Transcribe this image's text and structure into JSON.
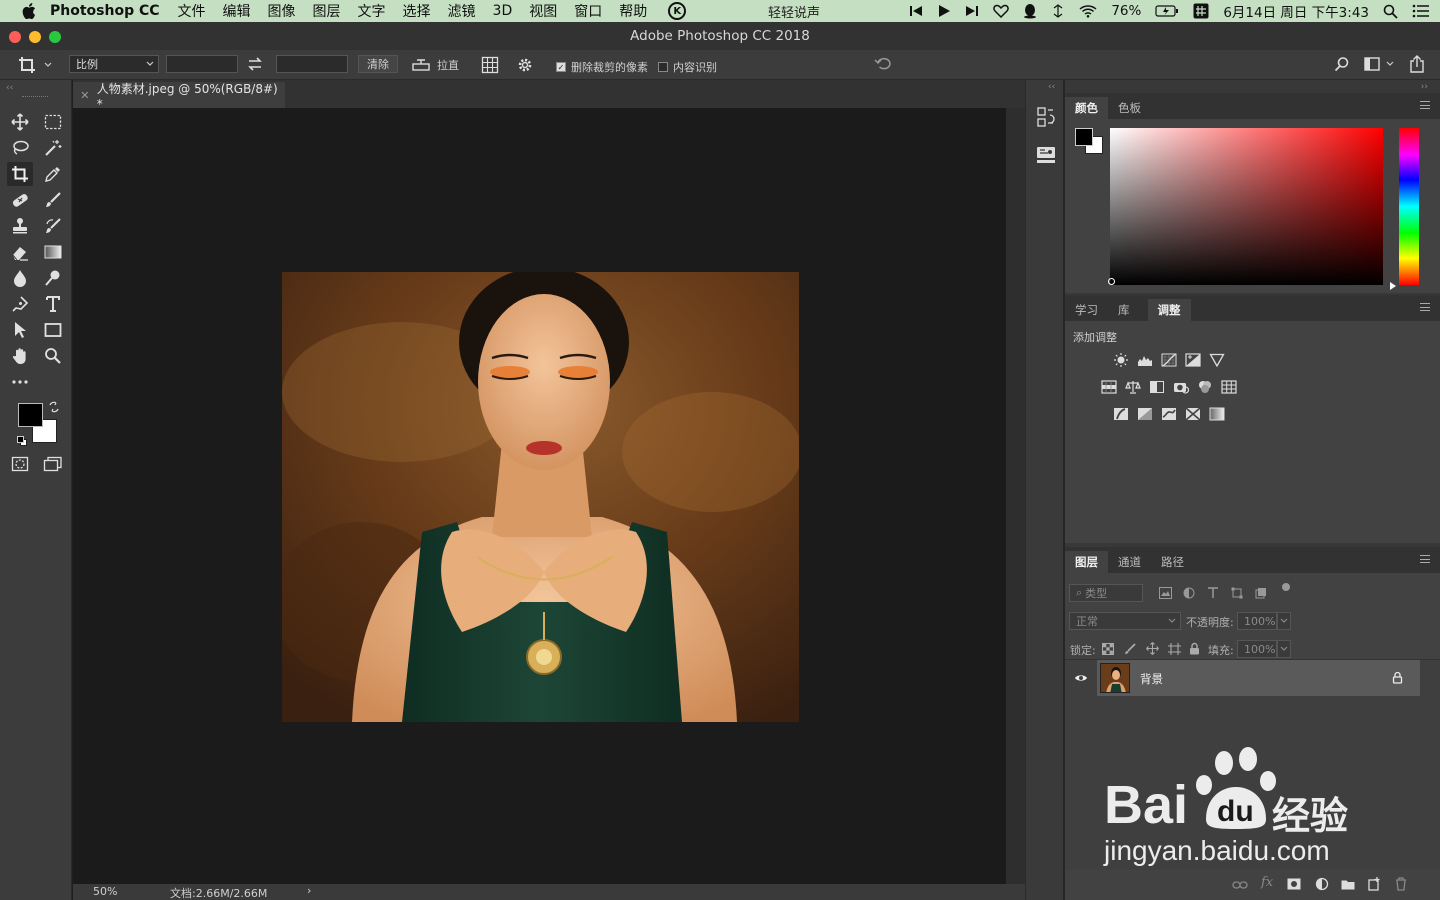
{
  "menubar": {
    "app_name": "Photoshop CC",
    "menus": [
      "文件",
      "编辑",
      "图像",
      "图层",
      "文字",
      "选择",
      "滤镜",
      "3D",
      "视图",
      "窗口",
      "帮助"
    ],
    "center_app": "轻轻说声",
    "battery": "76%",
    "datetime": "6月14日 周日 下午3:43",
    "k_icon_letter": "K"
  },
  "window": {
    "title": "Adobe Photoshop CC 2018",
    "colors": {
      "close": "#fc5f57",
      "minimize": "#fdbc2e",
      "maximize": "#28c840"
    }
  },
  "options": {
    "ratio_select": "比例",
    "clear_label": "清除",
    "straighten_label": "拉直",
    "delete_cropped_label": "删除裁剪的像素",
    "delete_cropped_checked": true,
    "content_aware_label": "内容识别",
    "content_aware_checked": false
  },
  "document": {
    "tab_label": "人物素材.jpeg @ 50%(RGB/8#) *",
    "zoom": "50%",
    "doc_size": "文档:2.66M/2.66M"
  },
  "color_panel": {
    "tabs": [
      "颜色",
      "色板"
    ],
    "active_tab": "颜色",
    "base_hue": "#ff0000"
  },
  "adjust_panel": {
    "tabs": [
      "学习",
      "库",
      "调整"
    ],
    "active_tab": "调整",
    "heading": "添加调整"
  },
  "layers_panel": {
    "tabs": [
      "图层",
      "通道",
      "路径"
    ],
    "active_tab": "图层",
    "filter_label": "类型",
    "blend_mode": "正常",
    "opacity_label": "不透明度:",
    "opacity_value": "100%",
    "lock_label": "锁定:",
    "fill_label": "填充:",
    "fill_value": "100%",
    "layers": [
      {
        "name": "背景",
        "visible": true,
        "locked": true
      }
    ]
  },
  "watermark": {
    "brand": "Bai",
    "brand_suffix": "经验",
    "url": "jingyan.baidu.com"
  }
}
